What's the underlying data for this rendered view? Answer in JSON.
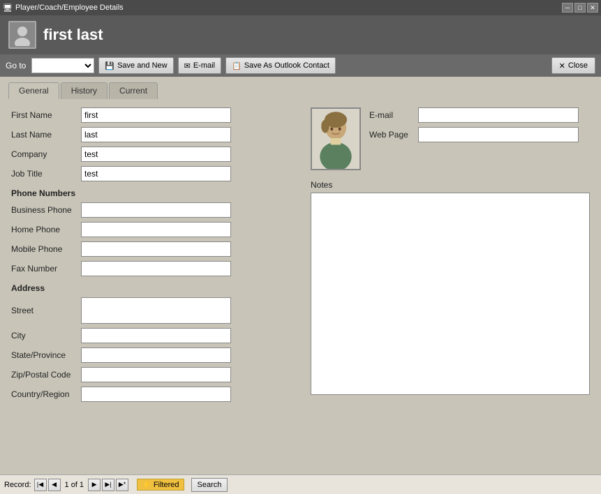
{
  "titleBar": {
    "title": "Player/Coach/Employee Details",
    "controls": [
      "minimize",
      "maximize",
      "close"
    ]
  },
  "header": {
    "title": "first last"
  },
  "toolbar": {
    "goto_label": "Go to",
    "goto_placeholder": "",
    "save_new_label": "Save and New",
    "email_label": "E-mail",
    "save_outlook_label": "Save As Outlook Contact",
    "close_label": "Close"
  },
  "tabs": [
    {
      "id": "general",
      "label": "General",
      "active": true
    },
    {
      "id": "history",
      "label": "History",
      "active": false
    },
    {
      "id": "current",
      "label": "Current",
      "active": false
    }
  ],
  "form": {
    "firstName": {
      "label": "First Name",
      "value": "first"
    },
    "lastName": {
      "label": "Last Name",
      "value": "last"
    },
    "company": {
      "label": "Company",
      "value": "test"
    },
    "jobTitle": {
      "label": "Job Title",
      "value": "test"
    },
    "phoneNumbers": {
      "header": "Phone Numbers",
      "fields": [
        {
          "label": "Business Phone",
          "value": ""
        },
        {
          "label": "Home Phone",
          "value": ""
        },
        {
          "label": "Mobile Phone",
          "value": ""
        },
        {
          "label": "Fax Number",
          "value": ""
        }
      ]
    },
    "address": {
      "header": "Address",
      "fields": [
        {
          "label": "Street",
          "value": ""
        },
        {
          "label": "City",
          "value": ""
        },
        {
          "label": "State/Province",
          "value": ""
        },
        {
          "label": "Zip/Postal Code",
          "value": ""
        },
        {
          "label": "Country/Region",
          "value": ""
        }
      ]
    },
    "email": {
      "label": "E-mail",
      "value": ""
    },
    "webPage": {
      "label": "Web Page",
      "value": ""
    },
    "notes": {
      "label": "Notes",
      "value": ""
    }
  },
  "statusBar": {
    "record_label": "Record:",
    "first_nav": "⏮",
    "prev_nav": "◀",
    "record_text": "1 of 1",
    "next_nav": "▶",
    "last_nav": "⏭",
    "extra_nav": "▶|",
    "filtered_label": "Filtered",
    "search_label": "Search"
  },
  "icons": {
    "save_icon": "💾",
    "email_icon": "✉",
    "outlook_icon": "📋",
    "close_icon": "✕",
    "title_icon": "👤"
  }
}
